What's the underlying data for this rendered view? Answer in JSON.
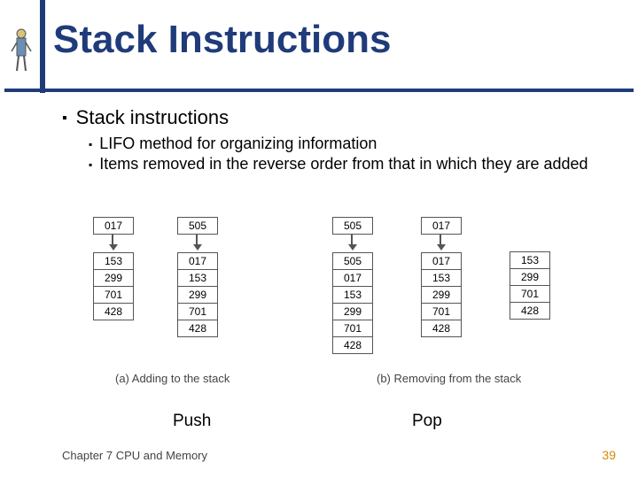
{
  "title": "Stack Instructions",
  "bullets": {
    "l1": "Stack instructions",
    "l2a": "LIFO method for organizing information",
    "l2b": "Items removed in the reverse order from that in which they are added"
  },
  "chart_data": {
    "type": "table",
    "description": "Stack push/pop sequence illustration",
    "stacks": [
      {
        "group": "push",
        "top": "017",
        "cells": [
          "153",
          "299",
          "701",
          "428"
        ]
      },
      {
        "group": "push",
        "top": "505",
        "cells": [
          "017",
          "153",
          "299",
          "701",
          "428"
        ]
      },
      {
        "group": "pop",
        "top": "505",
        "cells": [
          "505",
          "017",
          "153",
          "299",
          "701",
          "428"
        ]
      },
      {
        "group": "pop",
        "top": "017",
        "cells": [
          "017",
          "153",
          "299",
          "701",
          "428"
        ]
      },
      {
        "group": "pop",
        "top": "",
        "cells": [
          "153",
          "299",
          "701",
          "428"
        ]
      }
    ],
    "captions": {
      "a": "(a) Adding to the stack",
      "b": "(b) Removing from the stack"
    },
    "op_labels": {
      "push": "Push",
      "pop": "Pop"
    }
  },
  "footer": {
    "left": "Chapter 7 CPU and Memory",
    "page": "39"
  }
}
